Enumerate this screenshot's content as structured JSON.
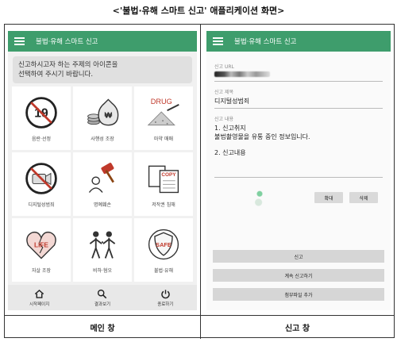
{
  "caption": "<'불법·유해 스마트 신고' 애플리케이션 화면>",
  "main": {
    "app_title": "불법·유해 스마트 신고",
    "notice": "신고하시고자 하는 주제의 아이콘을\n선택하여 주시기 바랍니다.",
    "categories": [
      {
        "label": "음란·선정",
        "icon": "no-19-icon"
      },
      {
        "label": "사행성 조장",
        "icon": "money-bag-icon"
      },
      {
        "label": "마약 매매",
        "icon": "drug-icon",
        "icon_text": "DRUG"
      },
      {
        "label": "디지털성범죄",
        "icon": "no-camera-icon"
      },
      {
        "label": "명예훼손",
        "icon": "defamation-icon"
      },
      {
        "label": "저작권 침해",
        "icon": "copy-icon",
        "icon_text": "COPY"
      },
      {
        "label": "자살 조장",
        "icon": "life-heart-icon",
        "icon_text": "LIFE"
      },
      {
        "label": "비하·혐오",
        "icon": "hate-people-icon"
      },
      {
        "label": "불법·유해",
        "icon": "safe-shield-icon",
        "icon_text": "SAFE"
      }
    ],
    "nav": [
      {
        "label": "시작페이지",
        "icon": "home-icon"
      },
      {
        "label": "결과보기",
        "icon": "search-icon"
      },
      {
        "label": "종료하기",
        "icon": "power-icon"
      }
    ],
    "footer_label": "메인 창"
  },
  "report": {
    "app_title": "불법·유해 스마트 신고",
    "url_label": "신고 URL",
    "subject_label": "신고 제목",
    "subject_value": "디지털성범죄",
    "content_label": "신고 내용",
    "content_line1": "1. 신고취지",
    "content_line2": "불법촬영물을 유통 중인 정보입니다.",
    "content_line3": "2. 신고내용",
    "zoom_button": "확대",
    "delete_button": "삭제",
    "report_button": "신고",
    "continue_button": "계속 신고하기",
    "attach_button": "첨부파일 추가",
    "footer_label": "신고 창"
  },
  "colors": {
    "appbar": "#3e9d6c",
    "icon_red": "#c0392b",
    "icon_dark": "#333333"
  }
}
